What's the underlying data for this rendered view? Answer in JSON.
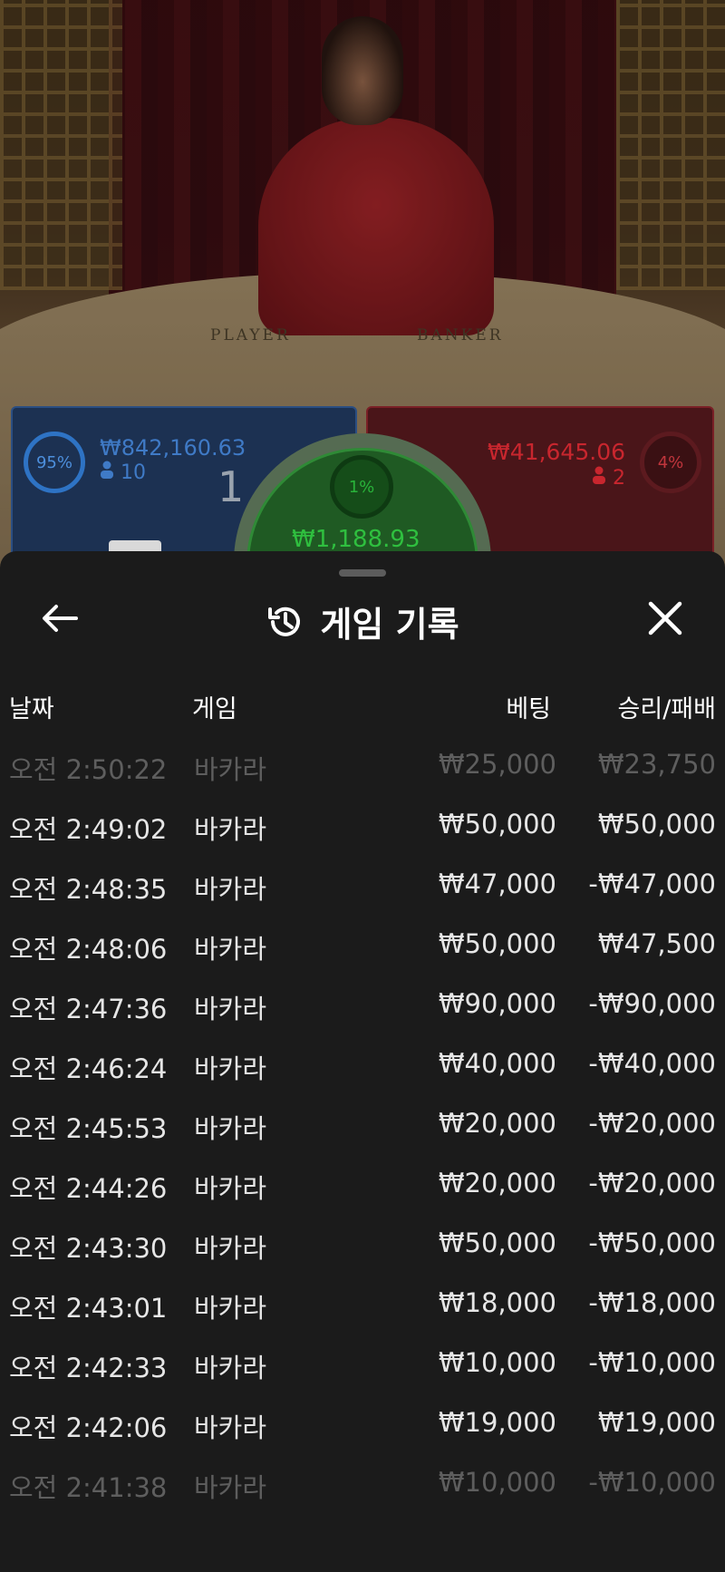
{
  "table": {
    "player_label": "PLAYER",
    "banker_label": "BANKER",
    "player": {
      "percent": "95%",
      "amount": "₩842,160.63",
      "players": "10",
      "score": "1"
    },
    "banker": {
      "percent": "4%",
      "amount": "₩41,645.06",
      "players": "2"
    },
    "tie": {
      "percent": "1%",
      "amount": "₩1,188.93"
    },
    "colors": {
      "player": "#2e73c4",
      "banker": "#c8262e",
      "tie": "#2fbf3f"
    }
  },
  "history": {
    "title": "게임 기록",
    "icons": {
      "back": "arrow-left-icon",
      "title": "history-icon",
      "close": "close-icon"
    },
    "columns": {
      "date": "날짜",
      "game": "게임",
      "bet": "베팅",
      "result": "승리/패배"
    },
    "rows": [
      {
        "date": "오전 2:50:22",
        "game": "바카라",
        "bet": "₩25,000",
        "result": "₩23,750"
      },
      {
        "date": "오전 2:49:02",
        "game": "바카라",
        "bet": "₩50,000",
        "result": "₩50,000"
      },
      {
        "date": "오전 2:48:35",
        "game": "바카라",
        "bet": "₩47,000",
        "result": "-₩47,000"
      },
      {
        "date": "오전 2:48:06",
        "game": "바카라",
        "bet": "₩50,000",
        "result": "₩47,500"
      },
      {
        "date": "오전 2:47:36",
        "game": "바카라",
        "bet": "₩90,000",
        "result": "-₩90,000"
      },
      {
        "date": "오전 2:46:24",
        "game": "바카라",
        "bet": "₩40,000",
        "result": "-₩40,000"
      },
      {
        "date": "오전 2:45:53",
        "game": "바카라",
        "bet": "₩20,000",
        "result": "-₩20,000"
      },
      {
        "date": "오전 2:44:26",
        "game": "바카라",
        "bet": "₩20,000",
        "result": "-₩20,000"
      },
      {
        "date": "오전 2:43:30",
        "game": "바카라",
        "bet": "₩50,000",
        "result": "-₩50,000"
      },
      {
        "date": "오전 2:43:01",
        "game": "바카라",
        "bet": "₩18,000",
        "result": "-₩18,000"
      },
      {
        "date": "오전 2:42:33",
        "game": "바카라",
        "bet": "₩10,000",
        "result": "-₩10,000"
      },
      {
        "date": "오전 2:42:06",
        "game": "바카라",
        "bet": "₩19,000",
        "result": "₩19,000"
      },
      {
        "date": "오전 2:41:38",
        "game": "바카라",
        "bet": "₩10,000",
        "result": "-₩10,000"
      }
    ]
  }
}
